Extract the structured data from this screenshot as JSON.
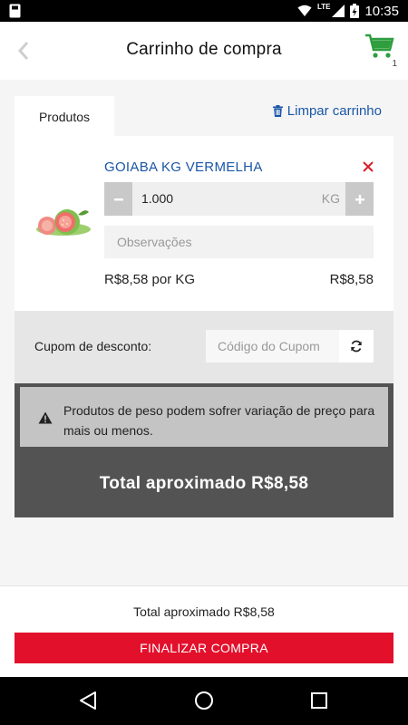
{
  "status_bar": {
    "network": "LTE",
    "time": "10:35"
  },
  "header": {
    "title": "Carrinho de compra",
    "cart_count": "1"
  },
  "tabs": {
    "products_label": "Produtos"
  },
  "clear_cart_label": "Limpar carrinho",
  "cart_items": [
    {
      "name": "GOIABA KG VERMELHA",
      "quantity": "1.000",
      "unit": "KG",
      "notes_placeholder": "Observações",
      "unit_price": "R$8,58 por KG",
      "line_total": "R$8,58"
    }
  ],
  "coupon": {
    "label": "Cupom de desconto:",
    "placeholder": "Código do Cupom"
  },
  "notice": {
    "text": "Produtos de peso podem sofrer variação de preço para mais ou menos."
  },
  "summary": {
    "approx_total": "Total aproximado R$8,58"
  },
  "footer": {
    "total_text": "Total aproximado R$8,58",
    "checkout_label": "FINALIZAR COMPRA"
  },
  "colors": {
    "accent_blue": "#1a56a8",
    "checkout_red": "#e3102b",
    "cart_green": "#2e9e3e",
    "remove_red": "#d8202a"
  }
}
